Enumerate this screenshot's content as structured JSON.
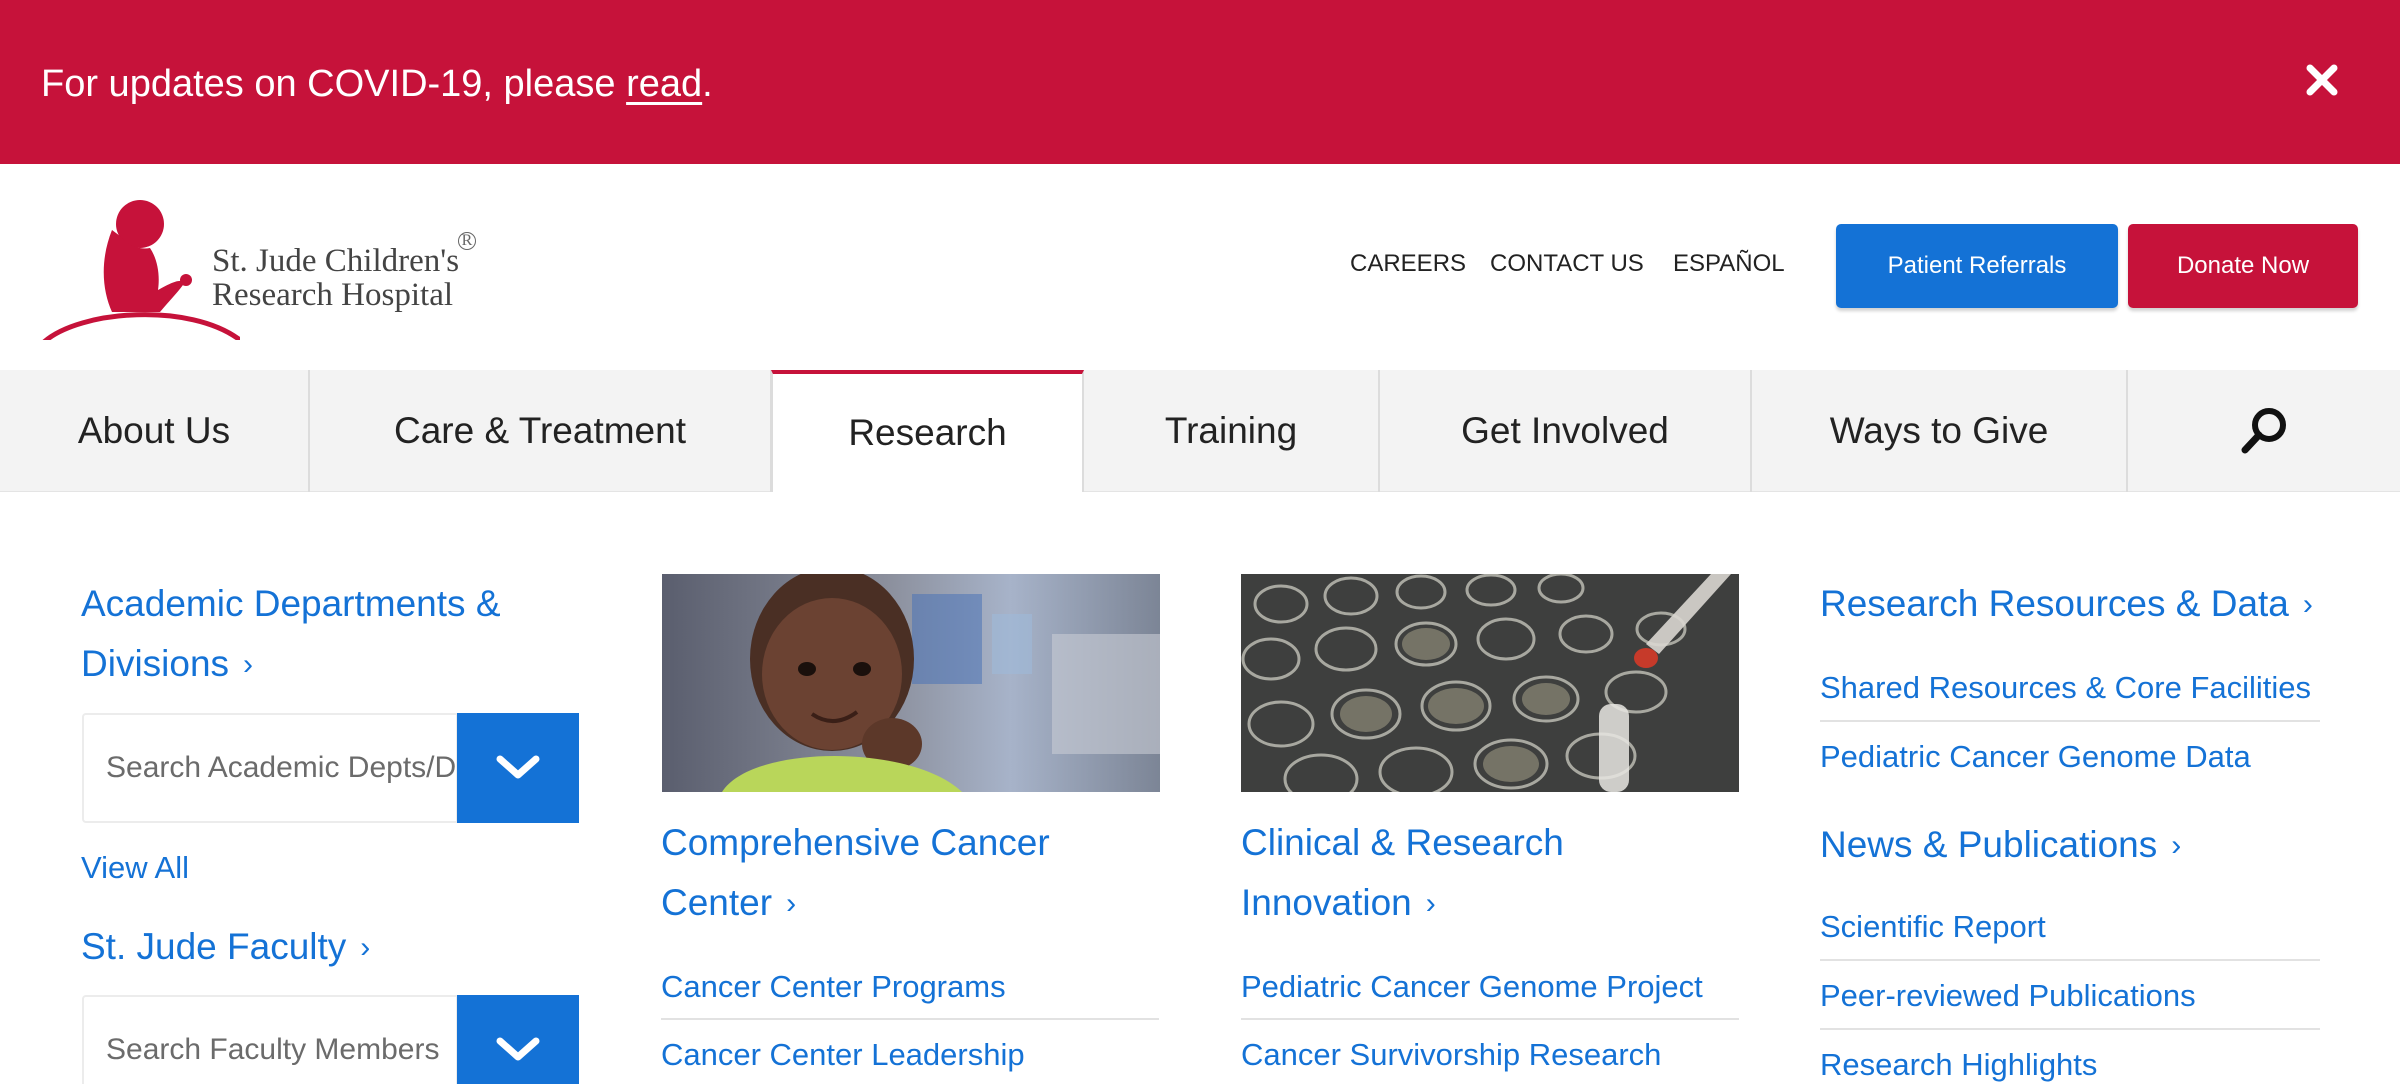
{
  "banner": {
    "prefix": "For updates on COVID-19, please ",
    "link_text": "read",
    "suffix": ".",
    "close_icon": "close-icon"
  },
  "header": {
    "logo_line1": "St. Jude Children's",
    "logo_line2": "Research Hospital",
    "logo_reg": "R",
    "utility_links": [
      "CAREERS",
      "CONTACT US",
      "ESPAÑOL"
    ],
    "patient_referrals": "Patient Referrals",
    "donate_now": "Donate Now"
  },
  "nav": {
    "items": [
      "About Us",
      "Care & Treatment",
      "Research",
      "Training",
      "Get Involved",
      "Ways to Give"
    ],
    "active": "Research",
    "search_icon": "search-icon"
  },
  "menu": {
    "col1": {
      "heading_line1": "Academic Departments &",
      "heading_line2": "Divisions",
      "search_placeholder": "Search Academic Depts/Divisions",
      "view_all": "View All",
      "faculty_heading": "St. Jude Faculty",
      "faculty_placeholder": "Search Faculty Members"
    },
    "col2": {
      "heading_line1": "Comprehensive Cancer",
      "heading_line2": "Center",
      "links": [
        "Cancer Center Programs",
        "Cancer Center Leadership"
      ]
    },
    "col3": {
      "heading_line1": "Clinical & Research",
      "heading_line2": "Innovation",
      "links": [
        "Pediatric Cancer Genome Project",
        "Cancer Survivorship Research"
      ]
    },
    "col4": {
      "heading": "Research Resources & Data",
      "links": [
        "Shared Resources & Core Facilities",
        "Pediatric Cancer Genome Data"
      ],
      "news_heading": "News & Publications",
      "news_links": [
        "Scientific Report",
        "Peer-reviewed Publications",
        "Research Highlights"
      ]
    },
    "chevron": "›"
  },
  "colors": {
    "brand_red": "#c6123a",
    "brand_blue": "#1472d6"
  }
}
